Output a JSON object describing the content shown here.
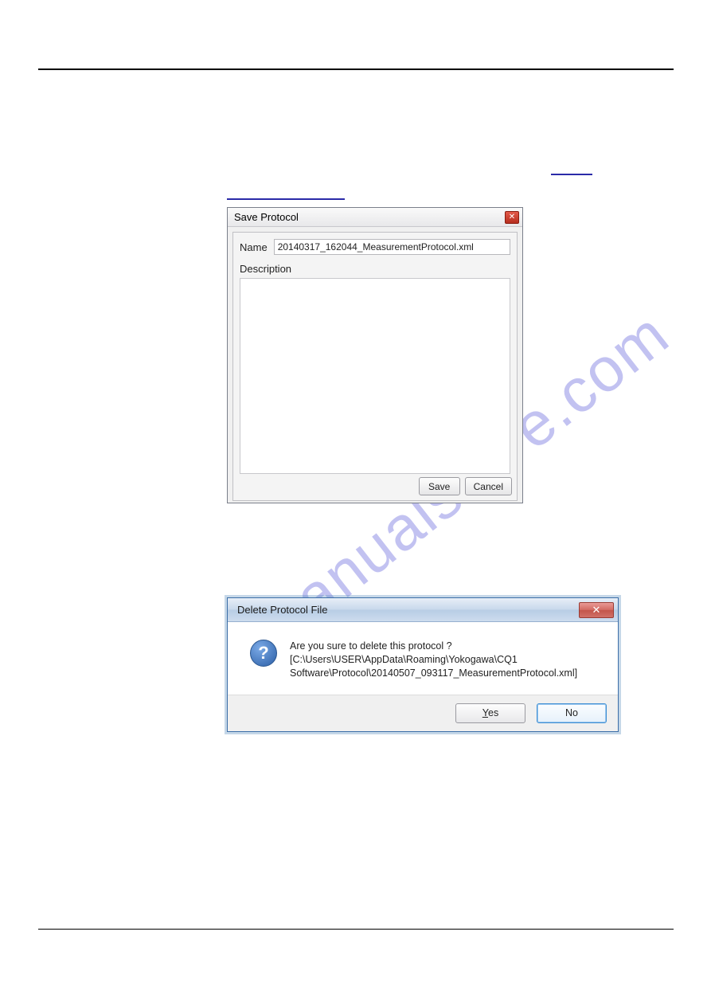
{
  "watermark": "manualshive.com",
  "save_dialog": {
    "title": "Save Protocol",
    "name_label": "Name",
    "name_value": "20140317_162044_MeasurementProtocol.xml",
    "description_label": "Description",
    "description_value": "",
    "save_label": "Save",
    "cancel_label": "Cancel"
  },
  "delete_dialog": {
    "title": "Delete Protocol File",
    "icon_glyph": "?",
    "message_line1": "Are you sure to delete this protocol ?",
    "message_line2": "[C:\\Users\\USER\\AppData\\Roaming\\Yokogawa\\CQ1",
    "message_line3": "Software\\Protocol\\20140507_093117_MeasurementProtocol.xml]",
    "yes_label": "Yes",
    "no_label": "No"
  }
}
